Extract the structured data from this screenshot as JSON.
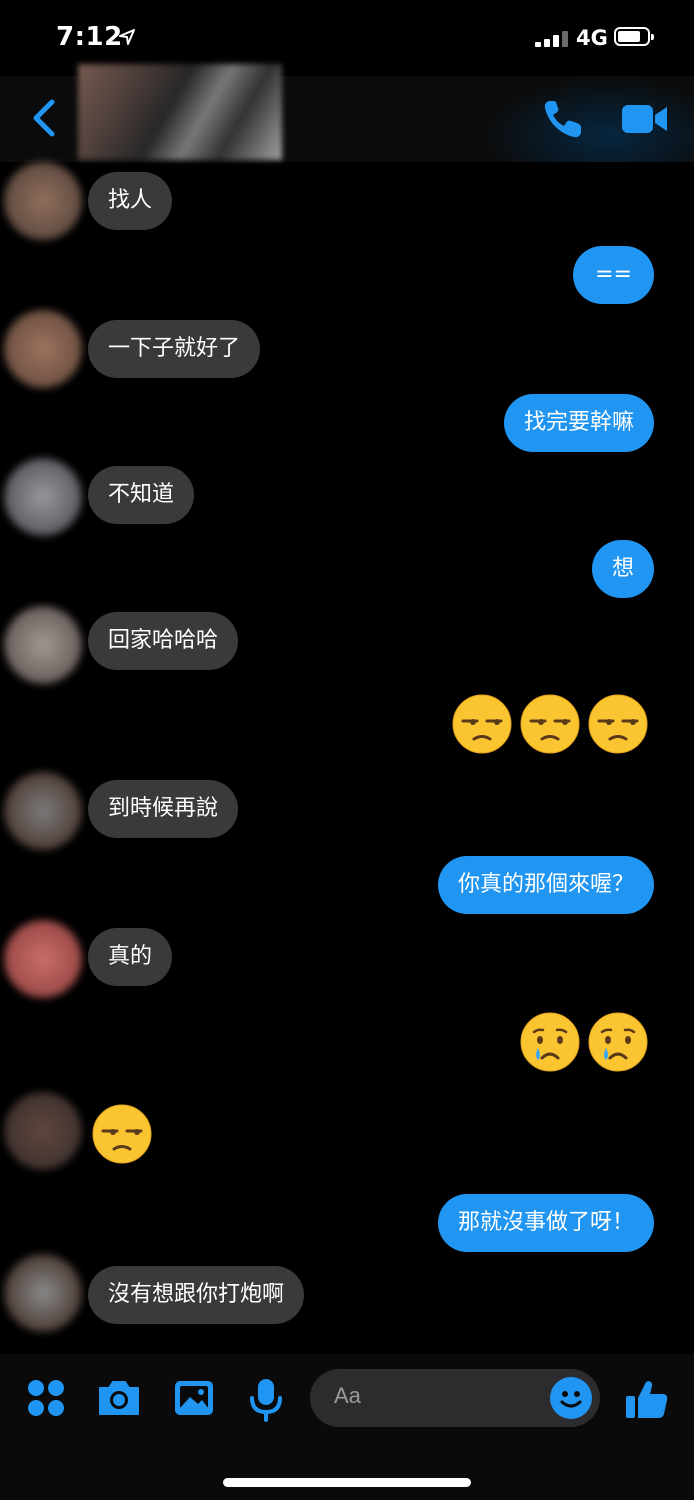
{
  "status_bar": {
    "time": "7:12",
    "network": "4G",
    "signal_bars": 3,
    "battery_level": 0.7
  },
  "header": {
    "back_icon": "chevron-left-icon",
    "call_icon": "phone-icon",
    "video_icon": "video-camera-icon",
    "accent": "#2095f2"
  },
  "messages": [
    {
      "dir": "in",
      "type": "text",
      "text": "找人"
    },
    {
      "dir": "out",
      "type": "text",
      "text": "=="
    },
    {
      "dir": "in",
      "type": "text",
      "text": "一下子就好了"
    },
    {
      "dir": "out",
      "type": "text",
      "text": "找完要幹嘛"
    },
    {
      "dir": "in",
      "type": "text",
      "text": "不知道"
    },
    {
      "dir": "out",
      "type": "text",
      "text": "想"
    },
    {
      "dir": "in",
      "type": "text",
      "text": "回家哈哈哈"
    },
    {
      "dir": "out",
      "type": "emoji",
      "emoji": "unamused-face",
      "count": 3
    },
    {
      "dir": "in",
      "type": "text",
      "text": "到時候再說"
    },
    {
      "dir": "out",
      "type": "text",
      "text": "你真的那個來喔？"
    },
    {
      "dir": "in",
      "type": "text",
      "text": "真的"
    },
    {
      "dir": "out",
      "type": "emoji",
      "emoji": "crying-face",
      "count": 2
    },
    {
      "dir": "in",
      "type": "emoji",
      "emoji": "unamused-face",
      "count": 1
    },
    {
      "dir": "out",
      "type": "text",
      "text": "那就沒事做了呀！"
    },
    {
      "dir": "in",
      "type": "text",
      "text": "沒有想跟你打炮啊"
    }
  ],
  "composer": {
    "placeholder": "Aa",
    "tools": [
      "apps-icon",
      "camera-icon",
      "photo-icon",
      "microphone-icon"
    ],
    "emoji_icon": "smiley-icon",
    "like_icon": "thumbs-up-icon"
  },
  "colors": {
    "background": "#000000",
    "incoming_bubble": "#3a3a3c",
    "outgoing_bubble": "#2095f2"
  }
}
